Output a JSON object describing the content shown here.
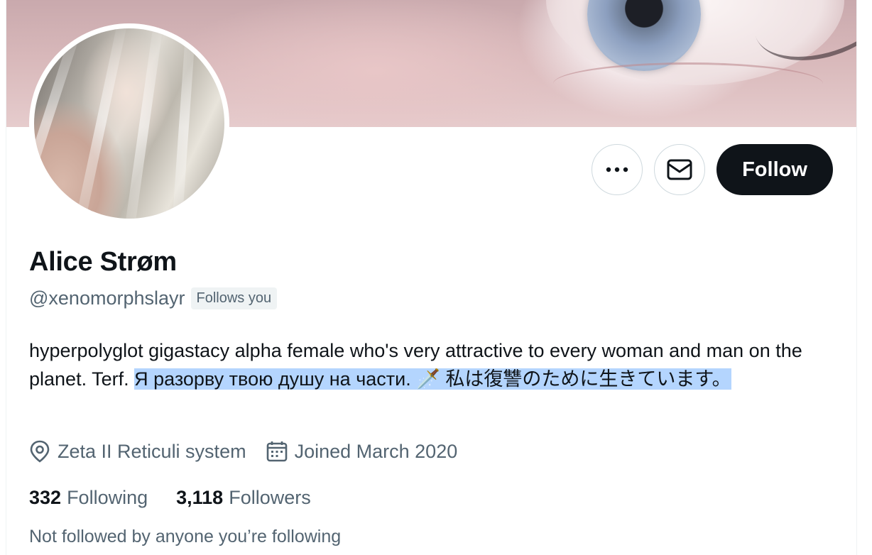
{
  "profile": {
    "display_name": "Alice Strøm",
    "handle": "@xenomorphslayr",
    "follows_you_badge": "Follows you",
    "bio": {
      "plain": "hyperpolyglot gigastacy alpha female who's very attractive to every woman and man on the planet. Terf. ",
      "selected": "Я разорву твою душу на части. 🗡️ 私は復讐のために生きています。"
    },
    "location": "Zeta II Reticuli system",
    "joined": "Joined March 2020",
    "following_count": "332",
    "following_label": "Following",
    "followers_count": "3,118",
    "followers_label": "Followers",
    "mutuals_note": "Not followed by anyone you’re following"
  },
  "actions": {
    "follow_label": "Follow",
    "more_icon": "ellipsis-icon",
    "message_icon": "envelope-icon"
  },
  "colors": {
    "primary_text": "#0f1419",
    "secondary_text": "#536471",
    "selection": "#b4d5fe",
    "follow_button_bg": "#0f1419",
    "border": "#cfd9de"
  }
}
